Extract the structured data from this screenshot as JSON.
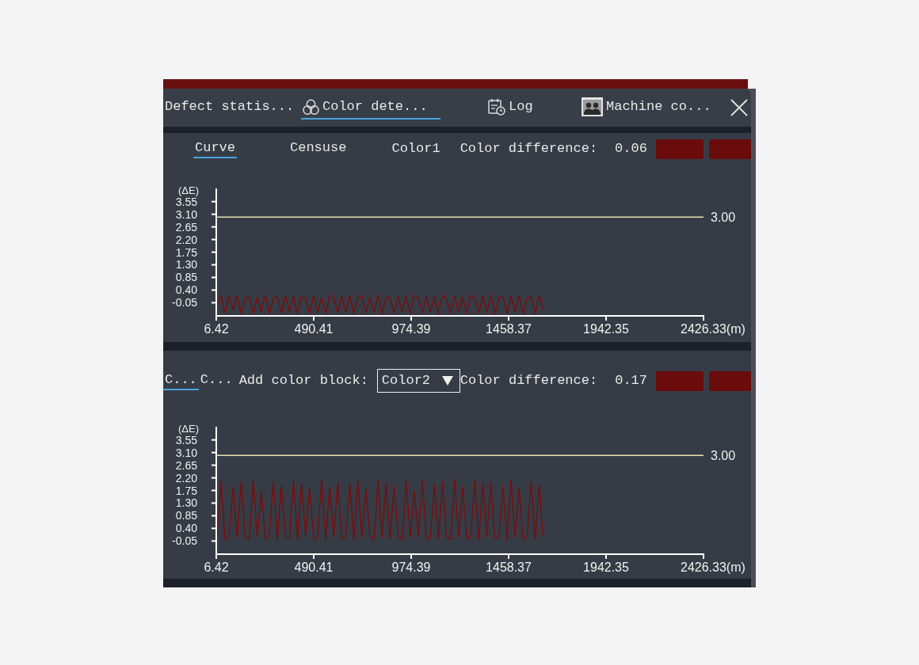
{
  "tabs": [
    {
      "label": "Defect statis...",
      "selected": false
    },
    {
      "label": "Color dete...",
      "selected": true
    },
    {
      "label": "Log",
      "selected": false
    },
    {
      "label": "Machine co...",
      "selected": false
    }
  ],
  "panels": [
    {
      "kind": "static",
      "subtabs": [
        {
          "label": "Curve",
          "selected": true
        },
        {
          "label": "Censuse",
          "selected": false
        }
      ],
      "color_label": "Color1",
      "difference_label": "Color difference:",
      "difference_value": "0.06",
      "swatches": [
        {
          "color": "#6b0c0c"
        },
        {
          "color": "#6b0c0c"
        }
      ],
      "chart_data": {
        "type": "line",
        "ylabel": "(ΔE)",
        "xlim": [
          6.42,
          2426.33
        ],
        "ylim": [
          -0.49,
          4.02
        ],
        "xticks": [
          6.42,
          490.41,
          974.39,
          1458.37,
          1942.35,
          {
            "value": 2426.33,
            "label": "2426.33(m)"
          }
        ],
        "yticks": [
          -0.05,
          {
            "value": 0.4,
            "label": "0.40"
          },
          0.85,
          {
            "value": 1.3,
            "label": "1.30"
          },
          1.75,
          {
            "value": 2.2,
            "label": "2.20"
          },
          2.65,
          {
            "value": 3.1,
            "label": "3.10"
          },
          3.55
        ],
        "ref_lines": [
          {
            "axis": "y",
            "value": 3.0,
            "label": "3.00",
            "color": "#e6dfb4"
          }
        ],
        "x": [
          10,
          30,
          50,
          70,
          90,
          110,
          130,
          150,
          170,
          190,
          210,
          230,
          250,
          270,
          290,
          310,
          330,
          350,
          370,
          390,
          410,
          430,
          450,
          470,
          490,
          510,
          530,
          550,
          570,
          590,
          610,
          630,
          650,
          670,
          690,
          710,
          730,
          750,
          770,
          790,
          810,
          830,
          850,
          870,
          890,
          910,
          930,
          950,
          970,
          990,
          1010,
          1030,
          1050,
          1070,
          1090,
          1110,
          1130,
          1150,
          1170,
          1190,
          1210,
          1230,
          1250,
          1270,
          1290,
          1310,
          1330,
          1350,
          1370,
          1390,
          1410,
          1430,
          1450,
          1470,
          1490,
          1510,
          1530,
          1550,
          1570,
          1590,
          1610,
          1630
        ],
        "series": [
          {
            "color": "#7a0c0c",
            "values": [
              -0.1,
              0.2,
              -0.42,
              0.18,
              -0.3,
              0.22,
              -0.45,
              0.1,
              0.2,
              -0.44,
              0.15,
              -0.38,
              0.24,
              -0.46,
              0.12,
              0.19,
              -0.43,
              0.2,
              -0.35,
              0.16,
              -0.45,
              0.22,
              0.08,
              -0.44,
              0.21,
              -0.4,
              0.14,
              -0.46,
              0.23,
              0.11,
              -0.42,
              0.18,
              -0.37,
              0.2,
              -0.45,
              0.15,
              0.21,
              -0.43,
              0.12,
              -0.4,
              0.24,
              -0.46,
              0.17,
              0.1,
              -0.44,
              0.2,
              -0.36,
              0.18,
              -0.45,
              0.22,
              0.13,
              -0.43,
              0.19,
              -0.39,
              0.16,
              -0.46,
              0.23,
              0.09,
              -0.44,
              0.2,
              -0.38,
              0.15,
              -0.45,
              0.21,
              0.14,
              -0.42,
              0.18,
              -0.4,
              0.24,
              -0.46,
              0.12,
              0.2,
              -0.43,
              0.17,
              -0.37,
              0.22,
              -0.45,
              0.1,
              0.19,
              -0.44,
              0.2,
              -0.3
            ]
          }
        ]
      }
    },
    {
      "kind": "dropdown",
      "subtabs": [
        {
          "label": "C...",
          "selected": true
        },
        {
          "label": "C...",
          "selected": false
        }
      ],
      "add_block_label": "Add color block:",
      "color_select": {
        "value": "Color2"
      },
      "difference_label": "Color difference:",
      "difference_value": "0.17",
      "swatches": [
        {
          "color": "#6b0c0c"
        },
        {
          "color": "#6b0c0c"
        }
      ],
      "chart_data": {
        "type": "line",
        "ylabel": "(ΔE)",
        "xlim": [
          6.42,
          2426.33
        ],
        "ylim": [
          -0.49,
          4.02
        ],
        "xticks": [
          6.42,
          490.41,
          974.39,
          1458.37,
          1942.35,
          {
            "value": 2426.33,
            "label": "2426.33(m)"
          }
        ],
        "yticks": [
          -0.05,
          {
            "value": 0.4,
            "label": "0.40"
          },
          0.85,
          {
            "value": 1.3,
            "label": "1.30"
          },
          1.75,
          {
            "value": 2.2,
            "label": "2.20"
          },
          2.65,
          {
            "value": 3.1,
            "label": "3.10"
          },
          3.55
        ],
        "ref_lines": [
          {
            "axis": "y",
            "value": 3.0,
            "label": "3.00",
            "color": "#e6dfb4"
          }
        ],
        "x": [
          10,
          30,
          50,
          70,
          90,
          110,
          130,
          150,
          170,
          190,
          210,
          230,
          250,
          270,
          290,
          310,
          330,
          350,
          370,
          390,
          410,
          430,
          450,
          470,
          490,
          510,
          530,
          550,
          570,
          590,
          610,
          630,
          650,
          670,
          690,
          710,
          730,
          750,
          770,
          790,
          810,
          830,
          850,
          870,
          890,
          910,
          930,
          950,
          970,
          990,
          1010,
          1030,
          1050,
          1070,
          1090,
          1110,
          1130,
          1150,
          1170,
          1190,
          1210,
          1230,
          1250,
          1270,
          1290,
          1310,
          1330,
          1350,
          1370,
          1390,
          1410,
          1430,
          1450,
          1470,
          1490,
          1510,
          1530,
          1550,
          1570,
          1590,
          1610,
          1630
        ],
        "series": [
          {
            "color": "#7a0c0c",
            "values": [
              0.05,
              2.1,
              0.0,
              0.1,
              1.9,
              0.05,
              2.05,
              0.1,
              0.0,
              2.12,
              0.08,
              1.7,
              0.02,
              0.12,
              2.08,
              0.0,
              1.95,
              0.1,
              0.05,
              2.1,
              0.0,
              2.0,
              0.15,
              1.85,
              0.03,
              0.1,
              2.15,
              0.0,
              1.9,
              0.08,
              2.05,
              0.02,
              0.12,
              1.98,
              0.0,
              2.1,
              0.05,
              1.8,
              0.1,
              0.0,
              2.12,
              0.07,
              2.0,
              0.02,
              1.92,
              0.1,
              0.0,
              2.08,
              0.05,
              1.75,
              0.12,
              2.1,
              0.0,
              0.08,
              1.95,
              0.03,
              2.05,
              0.1,
              0.0,
              2.15,
              0.06,
              1.88,
              0.02,
              0.1,
              2.1,
              0.0,
              1.97,
              0.08,
              2.02,
              0.04,
              0.11,
              1.9,
              0.0,
              2.12,
              0.07,
              1.85,
              0.02,
              0.1,
              2.05,
              0.0,
              1.95,
              0.08
            ]
          }
        ]
      }
    }
  ]
}
